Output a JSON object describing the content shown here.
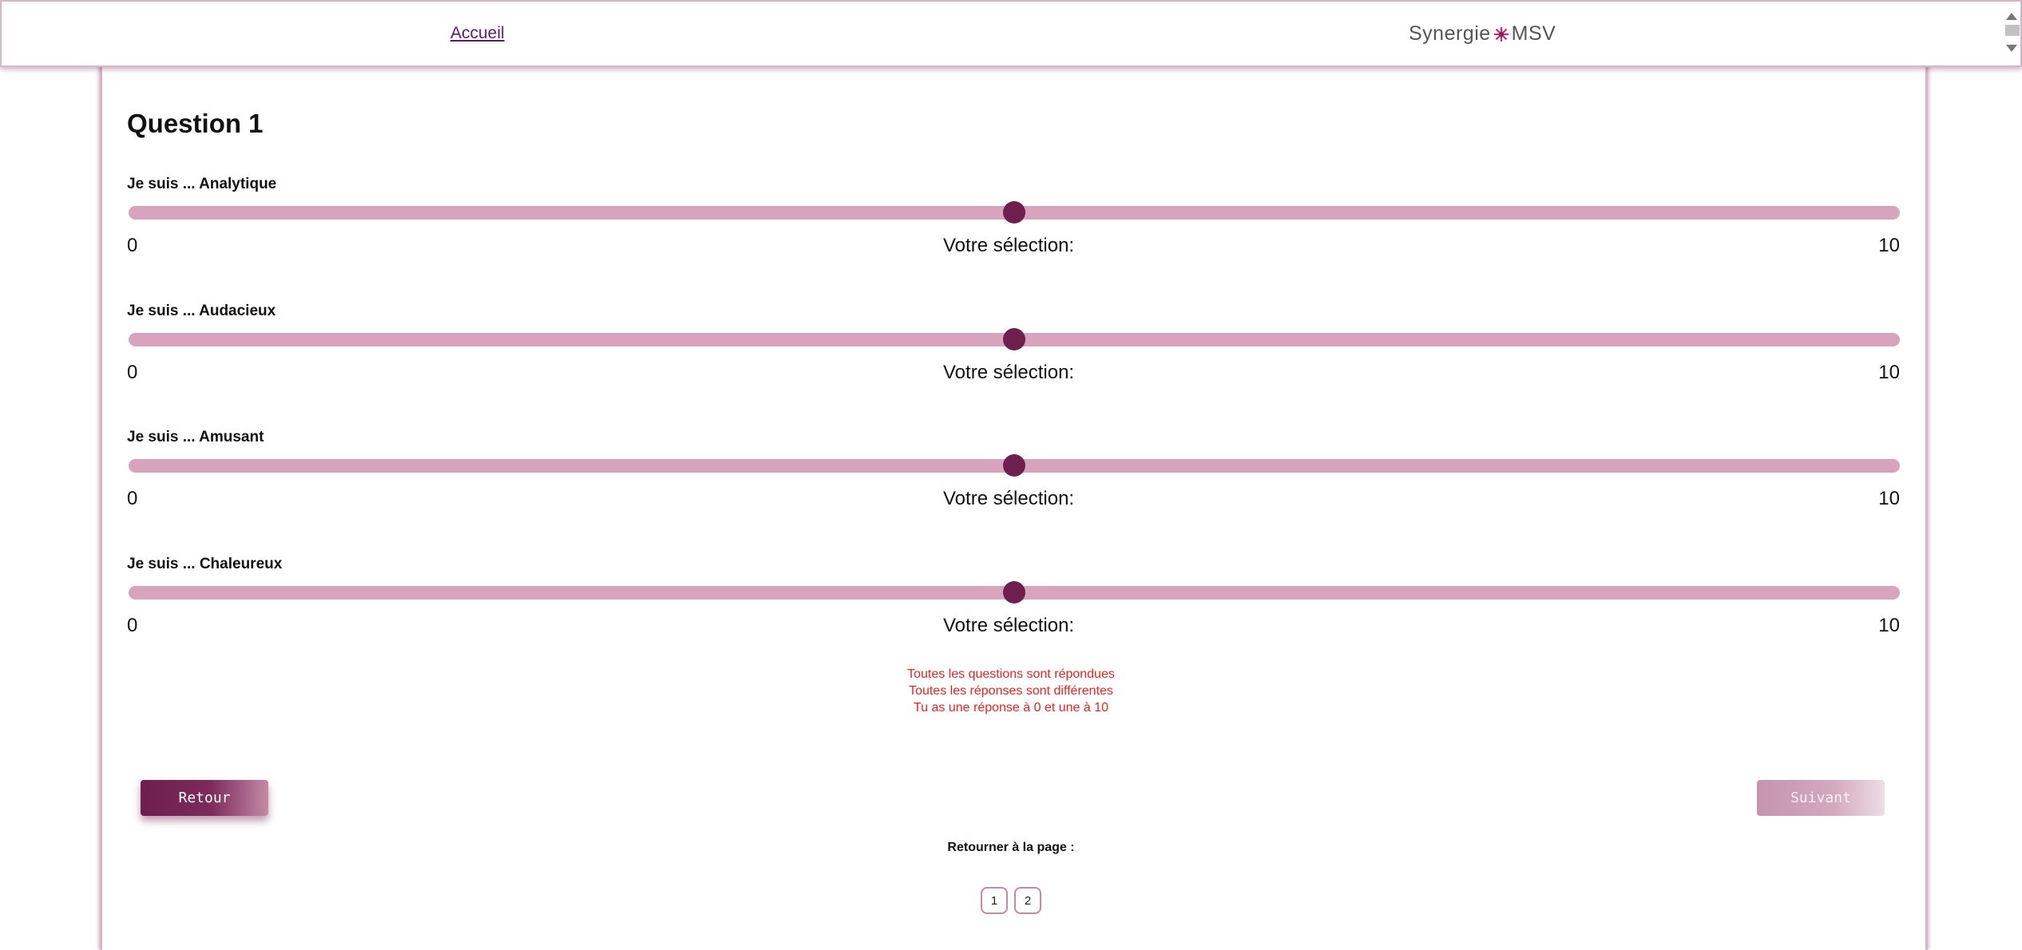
{
  "header": {
    "home_link": "Accueil",
    "brand_left": "Synergie",
    "brand_right": "MSV"
  },
  "question": {
    "title": "Question 1",
    "sliders": [
      {
        "label": "Je suis ... Analytique",
        "min": "0",
        "max": "10",
        "selection_label": "Votre sélection:",
        "value": 0.5
      },
      {
        "label": "Je suis ... Audacieux",
        "min": "0",
        "max": "10",
        "selection_label": "Votre sélection:",
        "value": 0.5
      },
      {
        "label": "Je suis ... Amusant",
        "min": "0",
        "max": "10",
        "selection_label": "Votre sélection:",
        "value": 0.5
      },
      {
        "label": "Je suis ... Chaleureux",
        "min": "0",
        "max": "10",
        "selection_label": "Votre sélection:",
        "value": 0.5
      }
    ]
  },
  "validation": [
    "Toutes les questions sont répondues",
    "Toutes les réponses sont différentes",
    "Tu as une réponse à 0 et une à 10"
  ],
  "nav": {
    "back_label": "Retour",
    "next_label": "Suivant",
    "return_label": "Retourner à la page :",
    "pages": [
      "1",
      "2"
    ]
  },
  "colors": {
    "accent": "#6e1f4e",
    "track": "#d8a4bd",
    "error": "#ee2222"
  }
}
